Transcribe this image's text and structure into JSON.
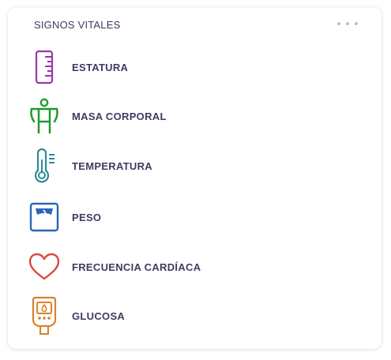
{
  "card": {
    "title": "SIGNOS VITALES",
    "menu_icon": "more-horizontal-icon"
  },
  "vitals": [
    {
      "label": "ESTATURA",
      "icon": "ruler-icon",
      "color": "#9b35a9"
    },
    {
      "label": "MASA CORPORAL",
      "icon": "person-body-icon",
      "color": "#1d9a2f"
    },
    {
      "label": "TEMPERATURA",
      "icon": "thermometer-icon",
      "color": "#2c8a93"
    },
    {
      "label": "PESO",
      "icon": "scale-icon",
      "color": "#2c66b8"
    },
    {
      "label": "FRECUENCIA CARDÍACA",
      "icon": "heart-icon",
      "color": "#d94a3f"
    },
    {
      "label": "GLUCOSA",
      "icon": "glucometer-icon",
      "color": "#d9822b"
    }
  ]
}
